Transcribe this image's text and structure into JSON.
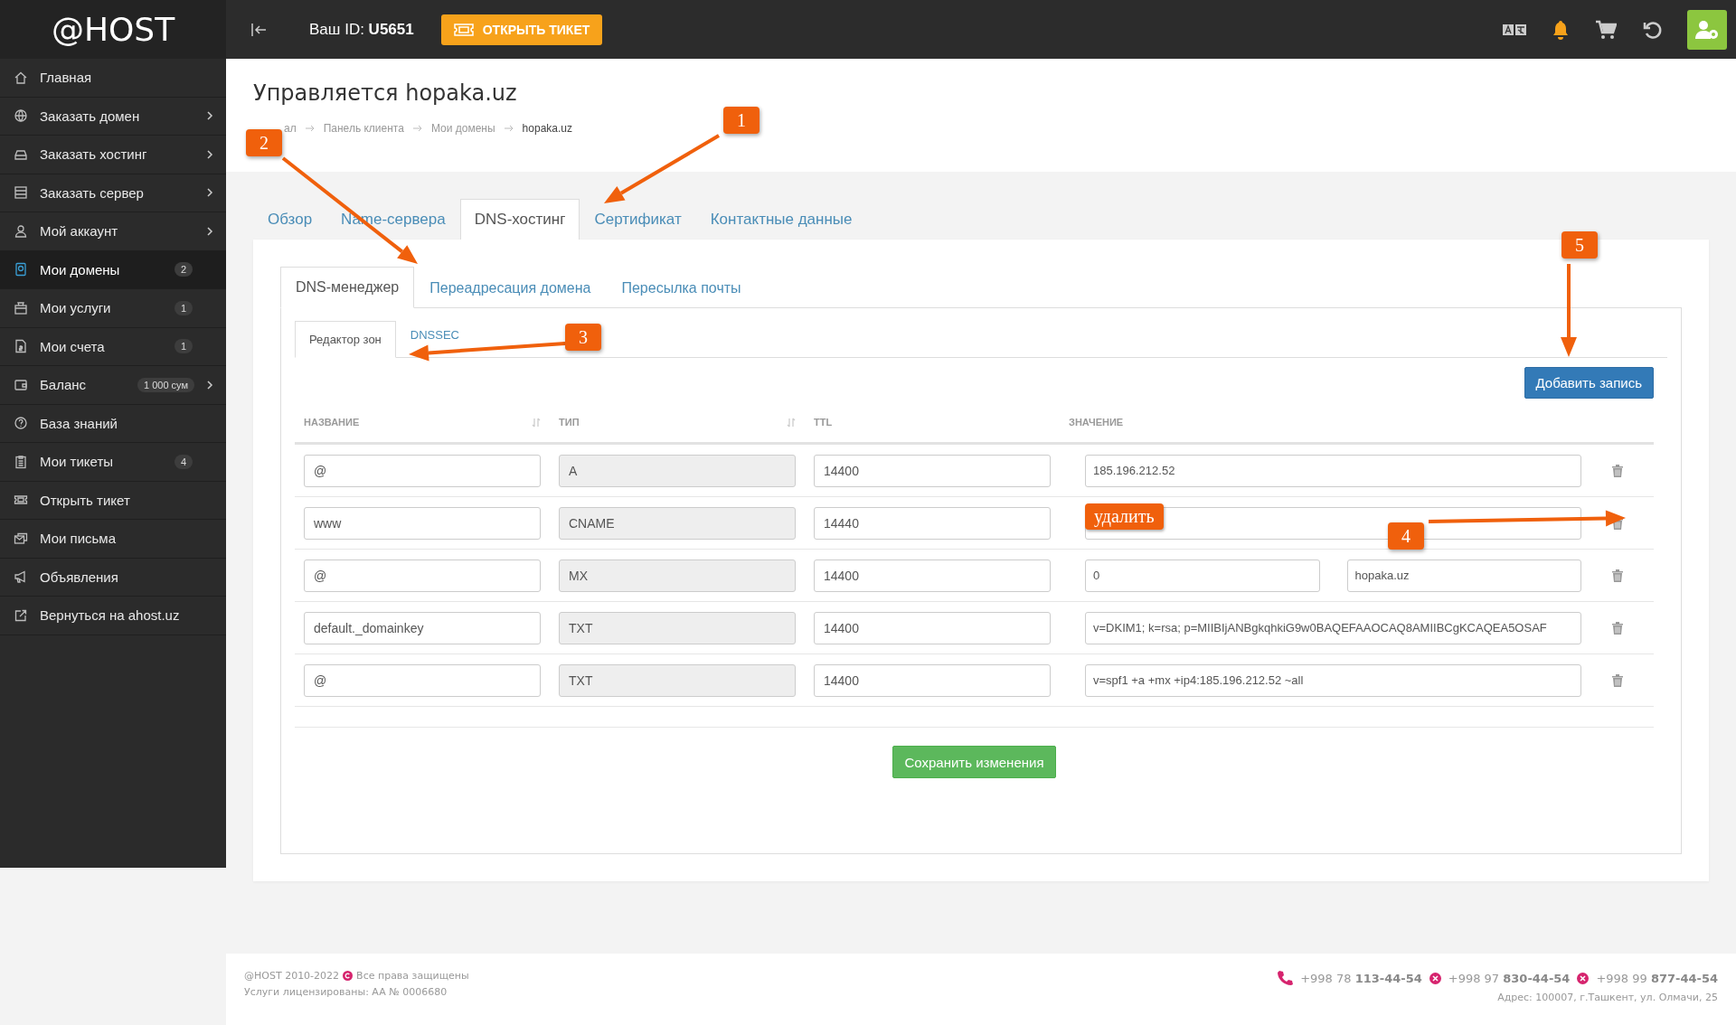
{
  "topbar": {
    "logo": "@HOST",
    "user_id": "Ваш ID: **U5651**",
    "ticket_button": "ОТКРЫТЬ ТИКЕТ"
  },
  "sidebar": {
    "items": [
      {
        "label": "Главная",
        "expandable": false,
        "selected": false
      },
      {
        "label": "Заказать домен",
        "expandable": true,
        "selected": false
      },
      {
        "label": "Заказать хостинг",
        "expandable": true,
        "selected": false
      },
      {
        "label": "Заказать сервер",
        "expandable": true,
        "selected": false
      },
      {
        "label": "Мой аккаунт",
        "expandable": true,
        "selected": false
      },
      {
        "label": "Мои домены",
        "badge": "2",
        "expandable": false,
        "selected": true
      },
      {
        "label": "Мои услуги",
        "badge": "1",
        "expandable": false,
        "selected": false
      },
      {
        "label": "Мои счета",
        "badge": "1",
        "expandable": false,
        "selected": false
      },
      {
        "label": "Баланс",
        "badge": "1 000 сум",
        "expandable": true,
        "selected": false
      },
      {
        "label": "База знаний",
        "expandable": false,
        "selected": false
      },
      {
        "label": "Мои тикеты",
        "badge": "4",
        "expandable": false,
        "selected": false
      },
      {
        "label": "Открыть тикет",
        "expandable": false,
        "selected": false
      },
      {
        "label": "Мои письма",
        "expandable": false,
        "selected": false
      },
      {
        "label": "Объявления",
        "expandable": false,
        "selected": false
      },
      {
        "label": "Вернуться на ahost.uz",
        "expandable": false,
        "selected": false
      }
    ]
  },
  "page": {
    "title": "Управляется hopaka.uz",
    "breadcrumbs": [
      "ал",
      "Панель клиента",
      "Мои домены",
      "hopaka.uz"
    ]
  },
  "tabs": [
    {
      "label": "Обзор",
      "selected": false
    },
    {
      "label": "Name-сервера",
      "selected": false
    },
    {
      "label": "DNS-хостинг",
      "selected": true
    },
    {
      "label": "Сертификат",
      "selected": false
    },
    {
      "label": "Контактные данные",
      "selected": false
    }
  ],
  "subtabs": [
    {
      "label": "DNS-менеджер",
      "selected": true
    },
    {
      "label": "Переадресация домена",
      "selected": false
    },
    {
      "label": "Пересылка почты",
      "selected": false
    }
  ],
  "zone_tabs": [
    {
      "label": "Редактор зон",
      "selected": true
    },
    {
      "label": "DNSSEC",
      "selected": false
    }
  ],
  "add_button": "Добавить запись",
  "table": {
    "columns": [
      "НАЗВАНИЕ",
      "ТИП",
      "TTL",
      "ЗНАЧЕНИЕ"
    ],
    "rows": [
      {
        "name": "@",
        "type": "A",
        "ttl": "14400",
        "values": [
          "185.196.212.52"
        ]
      },
      {
        "name": "www",
        "type": "CNAME",
        "ttl": "14440"
      },
      {
        "name": "@",
        "type": "MX",
        "ttl": "14400",
        "values": [
          "0",
          "hopaka.uz"
        ]
      },
      {
        "name": "default._domainkey",
        "type": "TXT",
        "ttl": "14400",
        "values": [
          "v=DKIM1; k=rsa; p=MIIBIjANBgkqhkiG9w0BAQEFAAOCAQ8AMIIBCgKCAQEA5OSAF"
        ]
      },
      {
        "name": "@",
        "type": "TXT",
        "ttl": "14400",
        "values": [
          "v=spf1 +a +mx +ip4:185.196.212.52 ~all"
        ]
      }
    ]
  },
  "save_button": "Сохранить изменения",
  "annotations": {
    "badges": [
      "1",
      "2",
      "3",
      "4",
      "5"
    ],
    "callout": "удалить"
  },
  "footer": {
    "copyright": "@HOST 2010-2022",
    "rights": "Все права защищены",
    "license": "Услуги лицензированы: AA № 0006680",
    "phones": [
      "+998 78 **113-44-54**",
      "+998 97 **830-44-54**",
      "+998 99 **877-44-54**"
    ],
    "address": "Адрес: 100007, г.Ташкент, ул. Олмачи, 25"
  }
}
